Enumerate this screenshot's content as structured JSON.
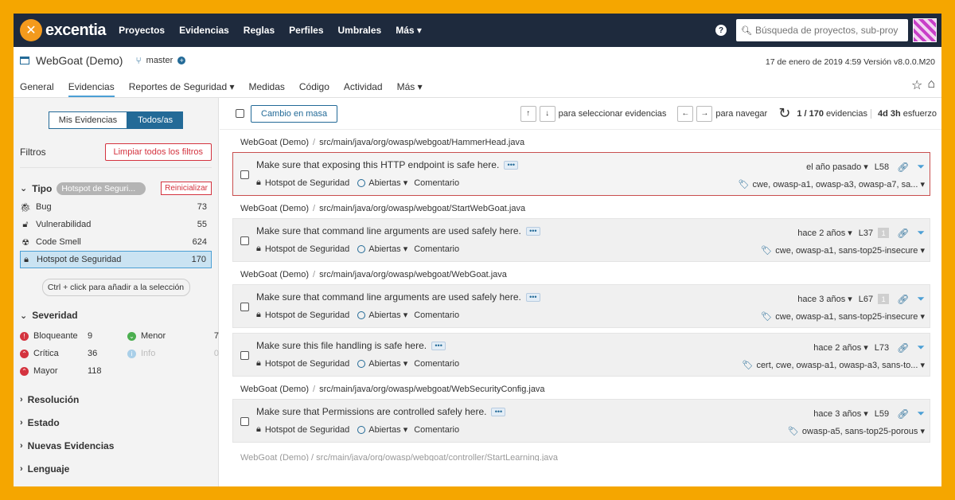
{
  "nav": {
    "logo_text": "excentia",
    "links": [
      "Proyectos",
      "Evidencias",
      "Reglas",
      "Perfiles",
      "Umbrales",
      "Más ▾"
    ],
    "search_placeholder": "Búsqueda de proyectos, sub-proy"
  },
  "project": {
    "name": "WebGoat (Demo)",
    "branch": "master",
    "meta": "17 de enero de 2019 4:59  Versión v8.0.0.M20",
    "tabs": [
      "General",
      "Evidencias",
      "Reportes de Seguridad ▾",
      "Medidas",
      "Código",
      "Actividad",
      "Más ▾"
    ]
  },
  "sidebar": {
    "toggle_mine": "Mis Evidencias",
    "toggle_all": "Todos/as",
    "filters_title": "Filtros",
    "clear_filters": "Limpiar todos los filtros",
    "type_facet": {
      "title": "Tipo",
      "pill": "Hotspot de Seguri...",
      "reset": "Reinicializar",
      "items": [
        {
          "label": "Bug",
          "count": "73"
        },
        {
          "label": "Vulnerabilidad",
          "count": "55"
        },
        {
          "label": "Code Smell",
          "count": "624"
        },
        {
          "label": "Hotspot de Seguridad",
          "count": "170"
        }
      ]
    },
    "hint": "Ctrl + click para añadir a la selección",
    "severity": {
      "title": "Severidad",
      "items": [
        {
          "label": "Bloqueante",
          "count": "9"
        },
        {
          "label": "Menor",
          "count": "7"
        },
        {
          "label": "Crítica",
          "count": "36"
        },
        {
          "label": "Info",
          "count": "0"
        },
        {
          "label": "Mayor",
          "count": "118"
        }
      ]
    },
    "collapsed": [
      "Resolución",
      "Estado",
      "Nuevas Evidencias",
      "Lenguaje"
    ]
  },
  "toolbar": {
    "bulk_change": "Cambio en masa",
    "select_hint": "para seleccionar evidencias",
    "nav_hint": "para navegar",
    "count": "1 / 170",
    "count_label": "evidencias",
    "effort": "4d 3h",
    "effort_label": "esfuerzo"
  },
  "issues": [
    {
      "project": "WebGoat (Demo)",
      "path": "src/main/java/org/owasp/webgoat/HammerHead.java",
      "message": "Make sure that exposing this HTTP endpoint is safe here.",
      "type": "Hotspot de Seguridad",
      "status": "Abiertas ▾",
      "comment": "Comentario",
      "age": "el año pasado ▾",
      "line": "L58",
      "badge": "",
      "tags": "cwe, owasp-a1, owasp-a3, owasp-a7, sa... ▾"
    },
    {
      "project": "WebGoat (Demo)",
      "path": "src/main/java/org/owasp/webgoat/StartWebGoat.java",
      "message": "Make sure that command line arguments are used safely here.",
      "type": "Hotspot de Seguridad",
      "status": "Abiertas ▾",
      "comment": "Comentario",
      "age": "hace 2 años ▾",
      "line": "L37",
      "badge": "1",
      "tags": "cwe, owasp-a1, sans-top25-insecure ▾"
    },
    {
      "project": "WebGoat (Demo)",
      "path": "src/main/java/org/owasp/webgoat/WebGoat.java",
      "message": "Make sure that command line arguments are used safely here.",
      "type": "Hotspot de Seguridad",
      "status": "Abiertas ▾",
      "comment": "Comentario",
      "age": "hace 3 años ▾",
      "line": "L67",
      "badge": "1",
      "tags": "cwe, owasp-a1, sans-top25-insecure ▾"
    },
    {
      "project": "",
      "path": "",
      "message": "Make sure this file handling is safe here.",
      "type": "Hotspot de Seguridad",
      "status": "Abiertas ▾",
      "comment": "Comentario",
      "age": "hace 2 años ▾",
      "line": "L73",
      "badge": "",
      "tags": "cert, cwe, owasp-a1, owasp-a3, sans-to... ▾"
    },
    {
      "project": "WebGoat (Demo)",
      "path": "src/main/java/org/owasp/webgoat/WebSecurityConfig.java",
      "message": "Make sure that Permissions are controlled safely here.",
      "type": "Hotspot de Seguridad",
      "status": "Abiertas ▾",
      "comment": "Comentario",
      "age": "hace 3 años ▾",
      "line": "L59",
      "badge": "",
      "tags": "owasp-a5, sans-top25-porous ▾"
    }
  ],
  "cut_header": "WebGoat (Demo) / src/main/java/org/owasp/webgoat/controller/StartLearning.java",
  "colors": {
    "frame": "#f5a600",
    "nav_bg": "#1e2a3d",
    "accent": "#236a97",
    "danger": "#d4333f",
    "selected_bg": "#cae3f2"
  }
}
